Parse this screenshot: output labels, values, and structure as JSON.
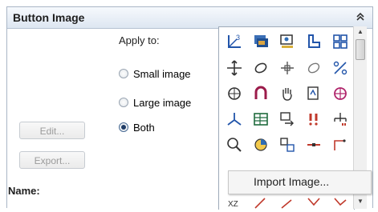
{
  "panel": {
    "title": "Button Image",
    "collapse_icon": "chevron-double-up-icon"
  },
  "apply_to": {
    "label": "Apply to:",
    "options": [
      {
        "label": "Small image",
        "selected": false
      },
      {
        "label": "Large image",
        "selected": false
      },
      {
        "label": "Both",
        "selected": true
      }
    ]
  },
  "buttons": {
    "edit": "Edit...",
    "export": "Export..."
  },
  "name_label": "Name:",
  "icon_grid": {
    "rows": [
      [
        "ucs-icon",
        "layer-stack-icon",
        "image-monitor-icon",
        "bracket-icon",
        "grid-block-icon"
      ],
      [
        "move-arrows-icon",
        "rotate-icon",
        "cross-arrows-icon",
        "loop-icon",
        "percent-icon"
      ],
      [
        "orbit-icon",
        "magnet-icon",
        "pan-hand-icon",
        "plot-icon",
        "globe-icon"
      ],
      [
        "axis-icon",
        "table-icon",
        "image-export-icon",
        "warning-icon",
        "tree-icon"
      ],
      [
        "zoom-icon",
        "pie-icon",
        "palette-icon",
        "line-icon",
        "polyline-icon"
      ],
      [
        "xyz-icon",
        "line-red-icon",
        "arc-icon",
        "angle-icon",
        "corner-icon"
      ]
    ]
  },
  "context_menu": {
    "items": [
      "Import Image..."
    ]
  }
}
